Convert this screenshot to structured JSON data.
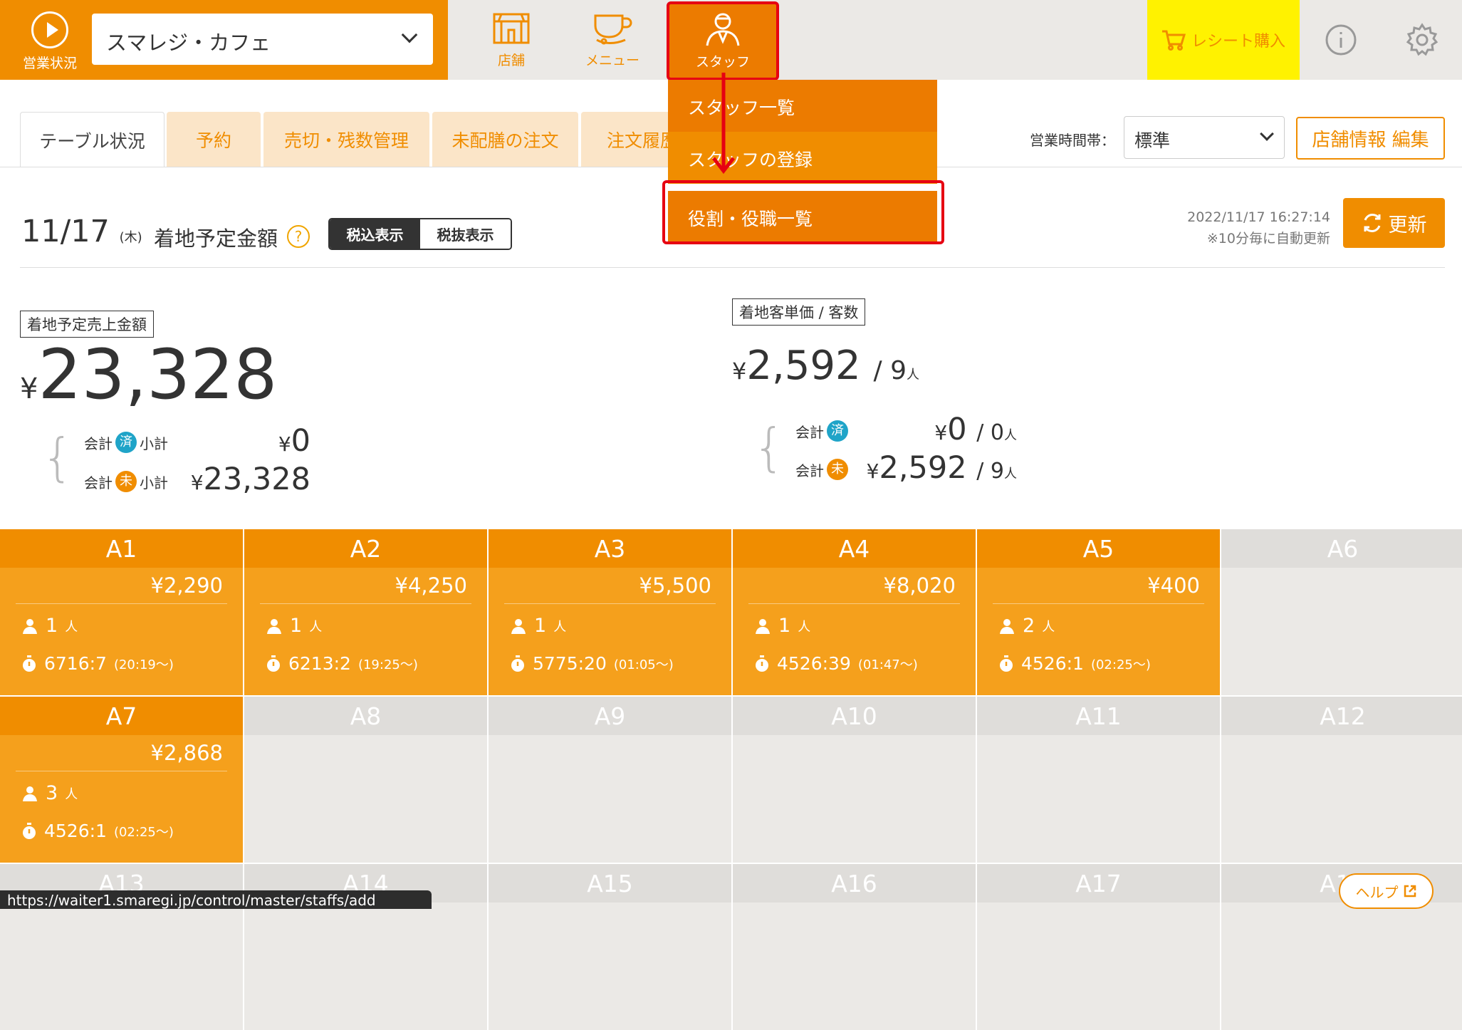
{
  "header": {
    "status_label": "営業状況",
    "store_name": "スマレジ・カフェ",
    "nav": [
      {
        "label": "店舗",
        "icon": "store-icon"
      },
      {
        "label": "メニュー",
        "icon": "cup-icon"
      },
      {
        "label": "スタッフ",
        "icon": "staff-icon"
      }
    ],
    "receipt_label": "レシート購入",
    "info_icon": "info-icon",
    "settings_icon": "gear-icon"
  },
  "staff_menu": {
    "items": [
      {
        "label": "スタッフ一覧",
        "color": "#ec7b00"
      },
      {
        "label": "スタッフの登録",
        "color": "#f08d00"
      },
      {
        "label": "役割・役職一覧",
        "color": "#ec7b00"
      }
    ]
  },
  "tabs": [
    {
      "label": "テーブル状況",
      "active": true
    },
    {
      "label": "予約",
      "active": false
    },
    {
      "label": "売切・残数管理",
      "active": false
    },
    {
      "label": "未配膳の注文",
      "active": false
    },
    {
      "label": "注文履歴",
      "active": false
    }
  ],
  "hours": {
    "label": "営業時間帯：",
    "value": "標準"
  },
  "edit_store_label": "店舗情報 編集",
  "summary": {
    "date": "11/17",
    "dow": "(木)",
    "title": "着地予定金額",
    "help_mark": "?",
    "tax_incl": "税込表示",
    "tax_excl": "税抜表示",
    "timestamp": "2022/11/17 16:27:14",
    "auto_note": "※10分毎に自動更新",
    "refresh_label": "更新"
  },
  "sales": {
    "label": "着地予定売上金額",
    "yen": "¥",
    "total": "23,328",
    "kaikei": "会計",
    "shoukei": "小計",
    "done_badge": "済",
    "undone_badge": "未",
    "done_amount": "0",
    "undone_amount": "23,328"
  },
  "unit": {
    "label": "着地客単価 / 客数",
    "price": "2,592",
    "slash_count": "/ 9",
    "nin": "人",
    "done_price": "0",
    "done_count": "/ 0",
    "undone_price": "2,592",
    "undone_count": "/ 9"
  },
  "tables": [
    {
      "name": "A1",
      "price": "¥2,290",
      "guests": "1",
      "time": "6716:7",
      "since": "(20:19〜)"
    },
    {
      "name": "A2",
      "price": "¥4,250",
      "guests": "1",
      "time": "6213:2",
      "since": "(19:25〜)"
    },
    {
      "name": "A3",
      "price": "¥5,500",
      "guests": "1",
      "time": "5775:20",
      "since": "(01:05〜)"
    },
    {
      "name": "A4",
      "price": "¥8,020",
      "guests": "1",
      "time": "4526:39",
      "since": "(01:47〜)"
    },
    {
      "name": "A5",
      "price": "¥400",
      "guests": "2",
      "time": "4526:1",
      "since": "(02:25〜)"
    },
    {
      "name": "A6"
    },
    {
      "name": "A7",
      "price": "¥2,868",
      "guests": "3",
      "time": "4526:1",
      "since": "(02:25〜)"
    },
    {
      "name": "A8"
    },
    {
      "name": "A9"
    },
    {
      "name": "A10"
    },
    {
      "name": "A11"
    },
    {
      "name": "A12"
    },
    {
      "name": "A13"
    },
    {
      "name": "A14"
    },
    {
      "name": "A15"
    },
    {
      "name": "A16"
    },
    {
      "name": "A17"
    },
    {
      "name": "A18"
    }
  ],
  "nin_unit": "人",
  "status_url": "https://waiter1.smaregi.jp/control/master/staffs/add",
  "help_label": "ヘルプ",
  "colors": {
    "accent": "#f08d00",
    "occupied": "#f5a01c",
    "empty": "#ebe9e6",
    "highlight": "#e60012",
    "receipt_bg": "#fff200"
  }
}
